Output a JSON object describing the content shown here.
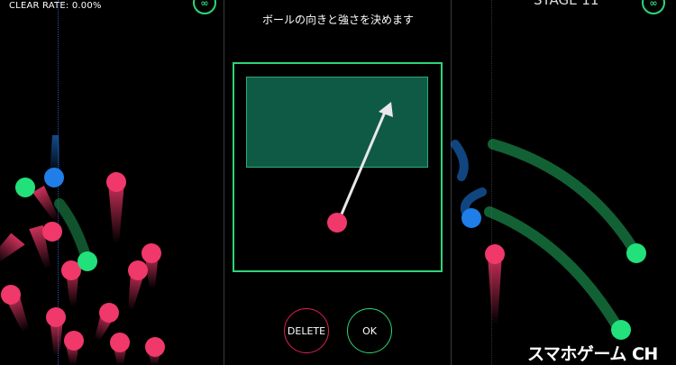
{
  "hud": {
    "clear_rate": "CLEAR RATE: 0.00%",
    "stage": "STAGE 11",
    "infinity_symbol": "∞"
  },
  "instruction": "ボールの向きと強さを決めます",
  "buttons": {
    "delete_label": "DELETE",
    "ok_label": "OK"
  },
  "watermark": "スマホゲーム CH",
  "colors": {
    "accent_green": "#2ed575",
    "ball_pink": "#f0386a",
    "ball_blue": "#1f7ee8",
    "ball_green": "#22e07a",
    "delete_red": "#e02050"
  },
  "icons": {
    "infinity": "infinity-icon",
    "aim_arrow": "arrow-icon"
  }
}
